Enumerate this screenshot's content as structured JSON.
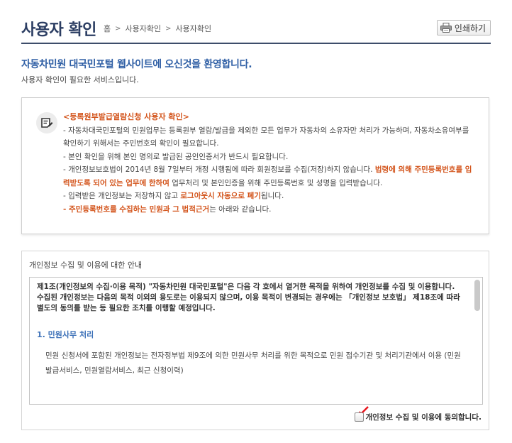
{
  "header": {
    "title": "사용자 확인",
    "breadcrumb": [
      "홈",
      "사용자확인",
      "사용자확인"
    ],
    "print_label": "인쇄하기"
  },
  "welcome": {
    "title": "자동차민원 대국민포털 웹사이트에 오신것을 환영합니다.",
    "subtitle": "사용자 확인이 필요한 서비스입니다."
  },
  "notice": {
    "title": "<등록원부발급열람신청 사용자 확인>",
    "line1": "- 자동차대국민포털의 민원업무는 등록원부 열람/발급을 제외한 모든 업무가 자동차의 소유자만 처리가 가능하며, 자동차소유여부를 확인하기 위해서는 주민번호의 확인이 필요합니다.",
    "line2": "- 본인 확인을 위해 본인 명의로 발급된 공인인증서가 반드시 필요합니다.",
    "line3_a": "- 개인정보보호법이 2014년 8월 7일부터 개정 시행됨에 따라 회원정보를 수집(저장)하지 않습니다. ",
    "line3_hl": "법령에 의해 주민등록번호를 입력받도록 되어 있는 업무에 한하여",
    "line3_b": " 업무처리 및 본인인증을 위해 주민등록번호 및 성명을 입력받습니다.",
    "line4_a": "- 입력받은 개인정보는 저장하지 않고 ",
    "line4_hl": "로그아웃시 자동으로 폐기",
    "line4_b": "됩니다.",
    "line5_dash": "- ",
    "line5_hl": "주민등록번호를 수집하는 민원과 그 법적근거",
    "line5_b": "는 아래와 같습니다."
  },
  "terms": {
    "heading": "개인정보 수집 및 이용에 대한 안내",
    "article": "제1조(개인정보의 수집·이용 목적) \"자동차민원 대국민포털\"은 다음 각 호에서 열거한 목적을 위하여 개인정보를 수집 및 이용합니다. 수집된 개인정보는 다음의 목적 이외의 용도로는 이용되지 않으며, 이용 목적이 변경되는 경우에는 「개인정보 보호법」 제18조에 따라 별도의 동의를 받는 등 필요한 조치를 이행할 예정입니다.",
    "section_title": "1. 민원사무 처리",
    "section_body": "민원 신청서에 포함된 개인정보는 전자정부법 제9조에 의한 민원사무 처리를 위한 목적으로 민원 접수기관 및 처리기관에서 이용 (민원발급서비스, 민원열람서비스, 최근 신청이력)",
    "agree_label": "개인정보 수집 및 이용에 동의합니다."
  },
  "colors": {
    "title": "#2c3e63",
    "welcome": "#2f5fa5",
    "highlight": "#d3541b",
    "section": "#3a6fb7",
    "arrow": "#e8141c"
  },
  "icons": [
    "printer-icon",
    "notice-memo-icon",
    "red-pointer-arrow-icon"
  ]
}
